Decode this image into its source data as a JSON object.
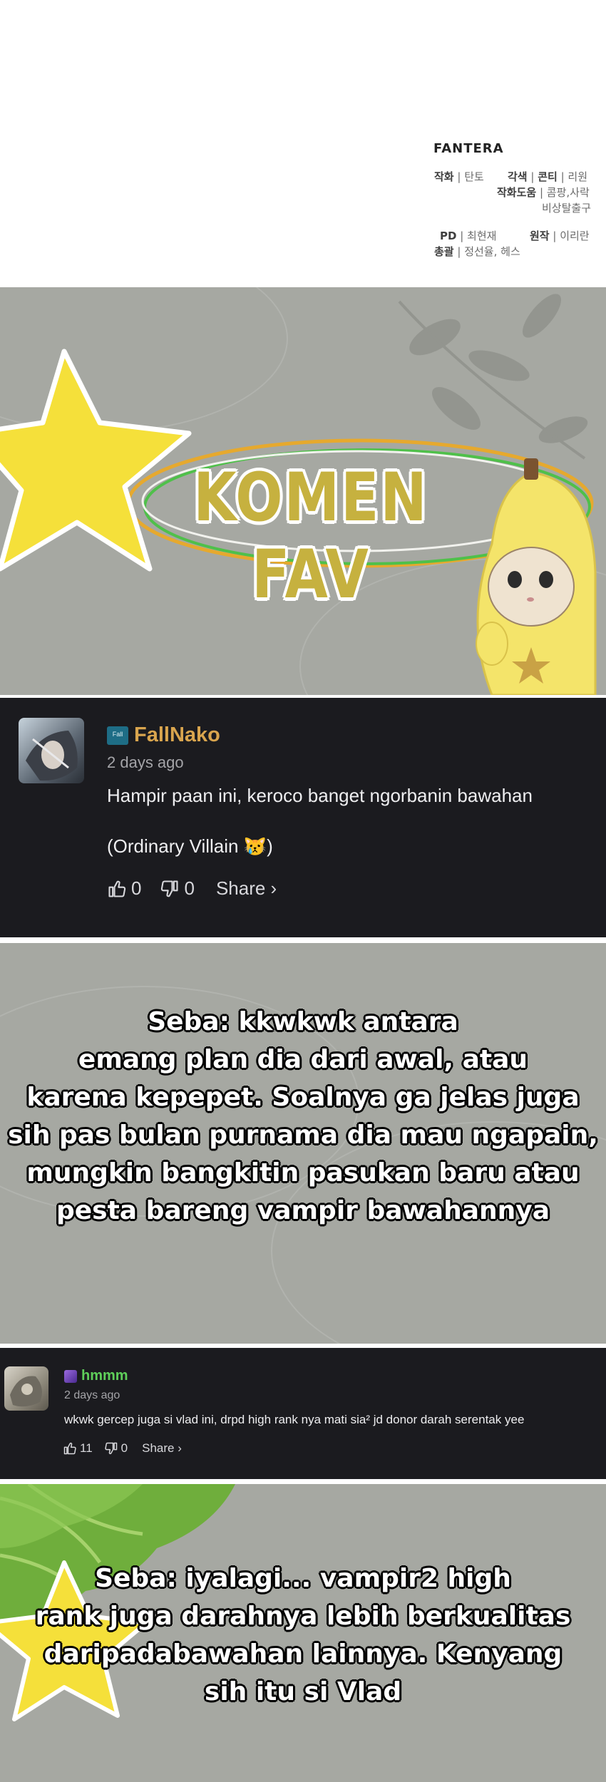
{
  "credits": {
    "brand": "FANTERA",
    "art_label": "작화",
    "art_value": "탄토",
    "color_label": "각색",
    "conti_label": "콘티",
    "conti_value": "리원",
    "assist_label": "작화도움",
    "assist_value": "콤팡,사락",
    "assist_value2": "비상탈출구",
    "pd_label": "PD",
    "pd_value": "최현재",
    "original_label": "원작",
    "original_value": "이리란",
    "general_label": "총괄",
    "general_value": "정선율, 헤스"
  },
  "banner": {
    "title": "KOMEN FAV"
  },
  "comments": [
    {
      "username": "FallNako",
      "badge": "Fall",
      "time": "2 days ago",
      "text": "Hampir paan ini, keroco banget ngorbanin bawahan",
      "text2": "(Ordinary Villain 😿)",
      "likes": "0",
      "dislikes": "0",
      "share": "Share ›",
      "username_color": "#d9a54e"
    },
    {
      "username": "hmmm",
      "time": "2 days ago",
      "text": "wkwk gercep juga si vlad ini, drpd high rank nya mati sia² jd donor darah serentak yee",
      "likes": "11",
      "dislikes": "0",
      "share": "Share ›",
      "username_color": "#5fcf5a"
    }
  ],
  "captions": {
    "reply1": [
      "Seba: kkwkwk antara",
      "emang plan dia dari awal, atau",
      "karena kepepet. Soalnya ga jelas juga",
      "sih pas bulan purnama dia mau ngapain,",
      "mungkin bangkitin pasukan baru atau",
      "pesta bareng vampir bawahannya"
    ],
    "reply2": [
      "Seba: iyalagi... vampir2 high",
      "rank juga darahnya lebih berkualitas",
      "daripadabawahan lainnya. Kenyang",
      "sih itu si Vlad"
    ]
  },
  "colors": {
    "panel_gray": "#a6a8a2",
    "comment_bg": "#1b1b1f",
    "star_yellow": "#f5e03a"
  }
}
